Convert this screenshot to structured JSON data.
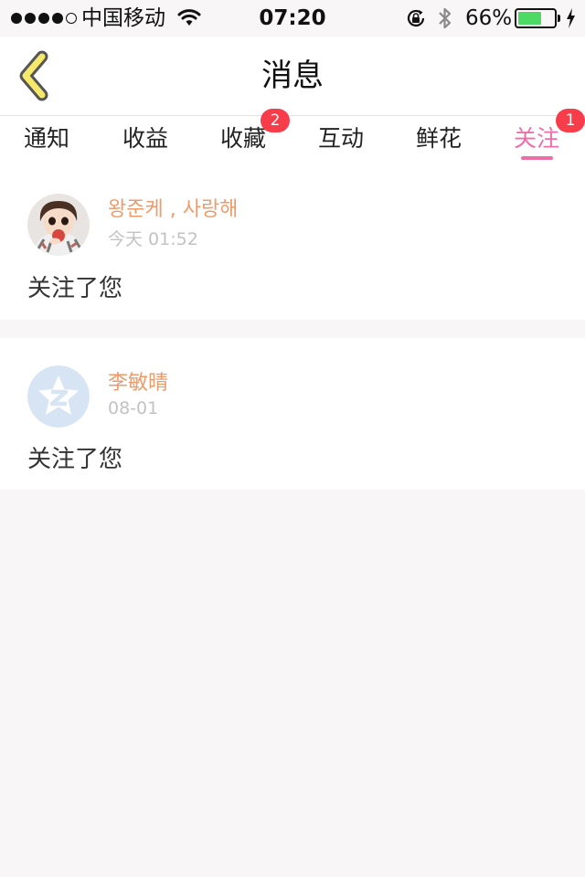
{
  "status_bar": {
    "carrier": "中国移动",
    "time": "07:20",
    "battery_percent": "66%",
    "battery_level": 0.66,
    "signal_bars_filled": 4,
    "signal_bars_total": 5
  },
  "nav": {
    "title": "消息",
    "back_icon": "chevron-left-icon"
  },
  "tabs": [
    {
      "label": "通知",
      "badge": null,
      "active": false
    },
    {
      "label": "收益",
      "badge": null,
      "active": false
    },
    {
      "label": "收藏",
      "badge": "2",
      "active": false
    },
    {
      "label": "互动",
      "badge": null,
      "active": false
    },
    {
      "label": "鲜花",
      "badge": null,
      "active": false
    },
    {
      "label": "关注",
      "badge": "1",
      "active": true
    }
  ],
  "messages": [
    {
      "name": "왕준케 , 사랑해",
      "time": "今天 01:52",
      "text": "关注了您"
    },
    {
      "name": "李敏晴",
      "time": "08-01",
      "text": "关注了您"
    }
  ],
  "colors": {
    "accent": "#ec6fa8",
    "badge": "#f73c4a",
    "username": "#ee9b6a",
    "timestamp": "#c2c2c2",
    "battery": "#4cd964",
    "back_chevron": "#f5e86a"
  }
}
